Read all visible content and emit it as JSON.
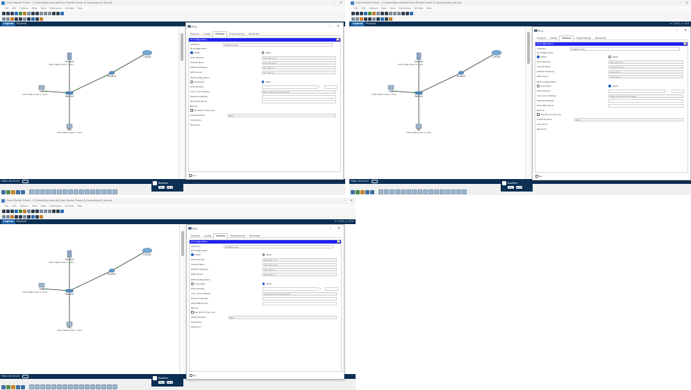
{
  "window": {
    "title": "Cisco Packet Tracer - C:\\Users\\Documents\\Cisco Packet Tracer 8.1\\saves\\ipv6_lab.pkt",
    "menu": [
      "File",
      "Edit",
      "Options",
      "View",
      "Tools",
      "Extensions",
      "Window",
      "Help"
    ]
  },
  "nav": {
    "logical": "Logical",
    "physical": "Physical",
    "coords": "x: 1102, y: 379"
  },
  "topology": {
    "devices": [
      {
        "id": "server0",
        "label": "Server0",
        "sub": "2001:DB8:ACAD:1::1/64"
      },
      {
        "id": "cloud0",
        "label": "Cloud0",
        "sub": ""
      },
      {
        "id": "router0",
        "label": "Router0",
        "sub": ""
      },
      {
        "id": "pc0",
        "label": "PC0",
        "sub": "2001:DB8:ACAD:1::2/64"
      },
      {
        "id": "switch0",
        "label": "Switch0",
        "sub": "Switch0"
      },
      {
        "id": "pc1",
        "label": "PC1",
        "sub": "2001:DB8:ACAD:1::3/64"
      }
    ]
  },
  "bottom": {
    "time": "Time: 00:12:45",
    "realtime": "Realtime",
    "play": "Play",
    "reset": "Reset",
    "toggle": "Toggle PDU List Window",
    "num": "62"
  },
  "dialog": {
    "title": "PC0",
    "tabs": [
      "Physical",
      "Config",
      "Desktop",
      "Programming",
      "Attributes"
    ],
    "active_tab": "Desktop",
    "ip_config_title": "IP Configuration",
    "close_x": "X",
    "interface_label": "Interface",
    "interface_value": "FastEthernet0",
    "ipv4_section": "IP Configuration",
    "dhcp": "DHCP",
    "static": "Static",
    "ipv4_address_label": "IPv4 Address",
    "ipv4_address_value": "192.168.1.10",
    "subnet_label": "Subnet Mask",
    "subnet_value": "255.255.255.0",
    "gateway_label": "Default Gateway",
    "gateway_value": "192.168.1.1",
    "dns_label": "DNS Server",
    "dns_value": "192.168.1.1",
    "ipv6_section": "IPv6 Configuration",
    "automatic": "Automatic",
    "ipv6_address_label": "IPv6 Address",
    "ipv6_prefix_sep": "/",
    "linklocal_label": "Link Local Address",
    "linklocal_value": "FE80::20C:CFFF:FE33:A05B",
    "ipv6_gateway_label": "Default Gateway",
    "ipv6_dns_label": "IPv6 DNS Server",
    "dot1x_section": "802.1X",
    "use_dot1x": "Use 802.1X Security",
    "auth_label": "Authentication",
    "auth_value": "MD5",
    "username_label": "Username",
    "password_label": "Password",
    "top_check": "Top"
  },
  "colors": {
    "nav": "#0c2f54",
    "ipcfg": "#2222ee",
    "link": "#22aa22"
  }
}
